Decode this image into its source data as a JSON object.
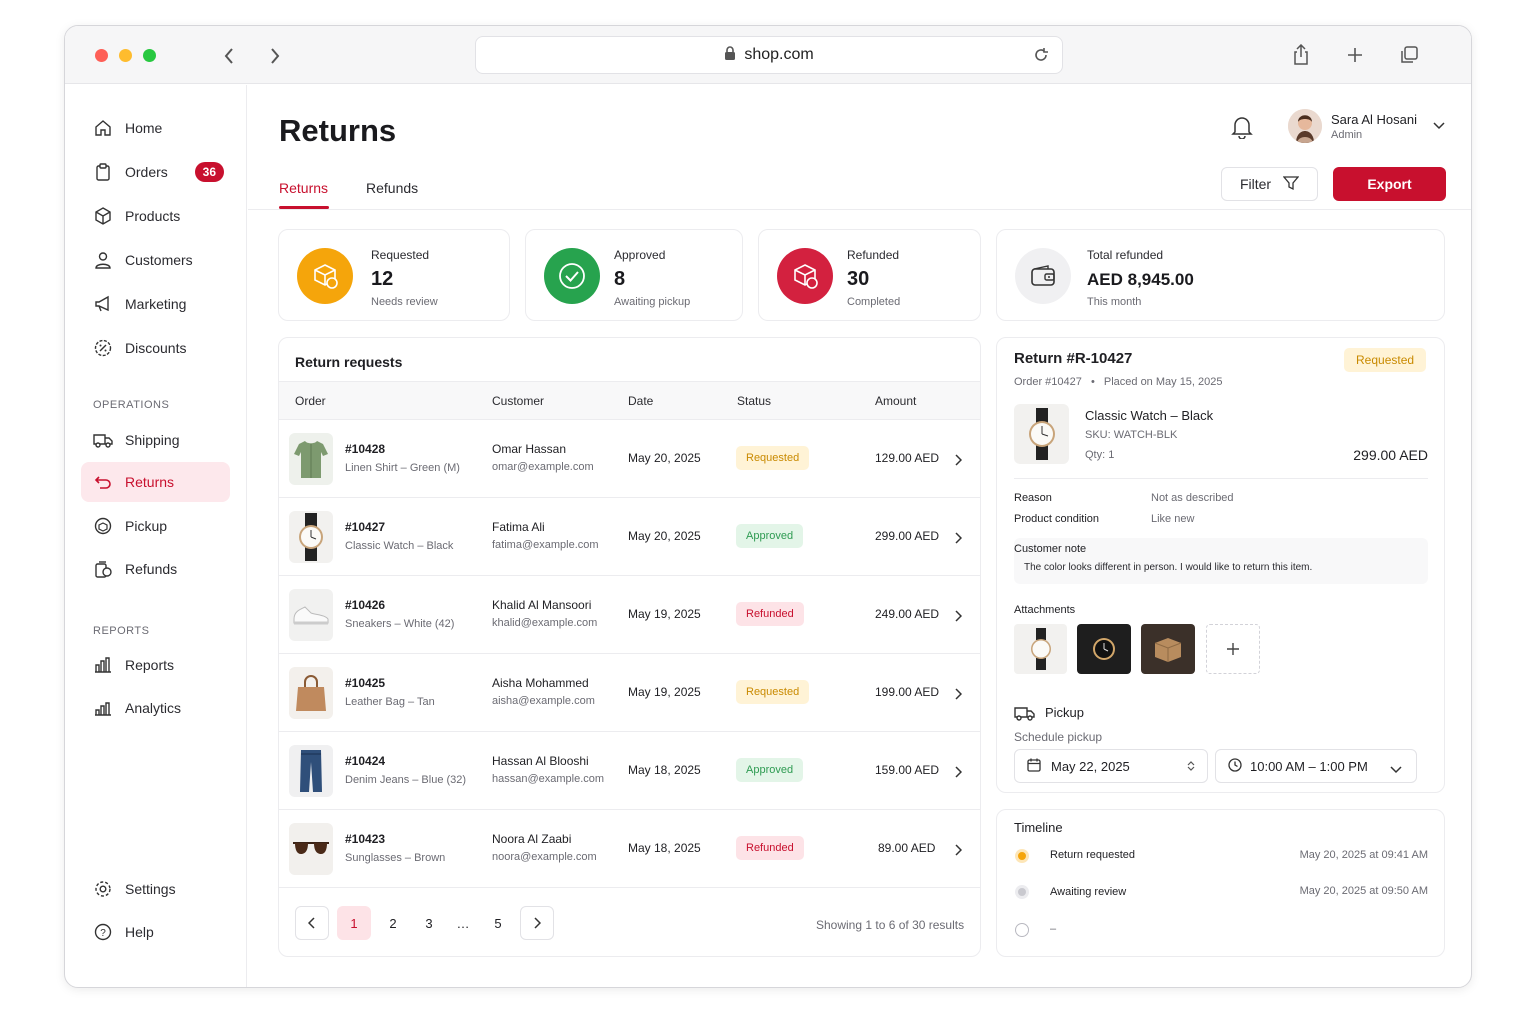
{
  "browser": {
    "url": "shop.com"
  },
  "sidebar": {
    "items": [
      {
        "label": "Home"
      },
      {
        "label": "Orders",
        "badge": "36"
      },
      {
        "label": "Products"
      },
      {
        "label": "Customers"
      },
      {
        "label": "Marketing"
      },
      {
        "label": "Discounts"
      }
    ],
    "operations_heading": "OPERATIONS",
    "operations": [
      {
        "label": "Shipping"
      },
      {
        "label": "Returns"
      },
      {
        "label": "Pickup"
      },
      {
        "label": "Refunds"
      }
    ],
    "reports_heading": "REPORTS",
    "reports": [
      {
        "label": "Reports"
      },
      {
        "label": "Analytics"
      }
    ],
    "footer": [
      {
        "label": "Settings"
      },
      {
        "label": "Help"
      }
    ],
    "active": "Returns",
    "accent": "#c8102e"
  },
  "header": {
    "title": "Returns",
    "tabs": [
      {
        "label": "Returns"
      },
      {
        "label": "Refunds"
      }
    ],
    "user": {
      "name": "Sara Al Hosani",
      "role": "Admin"
    },
    "filter_label": "Filter",
    "export_label": "Export"
  },
  "kpis": [
    {
      "label": "Requested",
      "value": "12",
      "sub": "Needs review",
      "color": "#f5a50b",
      "icon": "box-return-icon"
    },
    {
      "label": "Approved",
      "value": "8",
      "sub": "Awaiting pickup",
      "color": "#27a34e",
      "icon": "check-circle-icon"
    },
    {
      "label": "Refunded",
      "value": "30",
      "sub": "Completed",
      "color": "#d3213f",
      "icon": "box-refund-icon"
    },
    {
      "label": "Total refunded",
      "value": "AED 8,945.00",
      "sub": "This month",
      "color": "#f0f0f2",
      "icon": "wallet-icon"
    }
  ],
  "table": {
    "title": "Return requests",
    "columns": [
      "Order",
      "Customer",
      "Date",
      "Status",
      "Amount"
    ],
    "rows": [
      {
        "order": "#10428",
        "item": "Linen Shirt – Green (M)",
        "customer": "Omar Hassan",
        "email": "omar@example.com",
        "date": "May 20, 2025",
        "status": "Requested",
        "amount": "129.00 AED",
        "thumb": "shirt-icon"
      },
      {
        "order": "#10427",
        "item": "Classic Watch – Black",
        "customer": "Fatima Ali",
        "email": "fatima@example.com",
        "date": "May 20, 2025",
        "status": "Approved",
        "amount": "299.00 AED",
        "thumb": "watch-icon"
      },
      {
        "order": "#10426",
        "item": "Sneakers – White (42)",
        "customer": "Khalid Al Mansoori",
        "email": "khalid@example.com",
        "date": "May 19, 2025",
        "status": "Refunded",
        "amount": "249.00 AED",
        "thumb": "sneaker-icon"
      },
      {
        "order": "#10425",
        "item": "Leather Bag – Tan",
        "customer": "Aisha Mohammed",
        "email": "aisha@example.com",
        "date": "May 19, 2025",
        "status": "Requested",
        "amount": "199.00 AED",
        "thumb": "bag-icon"
      },
      {
        "order": "#10424",
        "item": "Denim Jeans – Blue (32)",
        "customer": "Hassan Al Blooshi",
        "email": "hassan@example.com",
        "date": "May 18, 2025",
        "status": "Approved",
        "amount": "159.00 AED",
        "thumb": "jeans-icon"
      },
      {
        "order": "#10423",
        "item": "Sunglasses – Brown",
        "customer": "Noora Al Zaabi",
        "email": "noora@example.com",
        "date": "May 18, 2025",
        "status": "Refunded",
        "amount": "89.00 AED",
        "thumb": "sunglasses-icon"
      }
    ],
    "pagination": {
      "pages": [
        "1",
        "2",
        "3",
        "…",
        "5"
      ],
      "current": "1",
      "summary": "Showing 1 to 6 of 30 results"
    }
  },
  "detail": {
    "title": "Return #R-10427",
    "status": "Requested",
    "order": "Order #10427",
    "sep": "•",
    "placed": "Placed on May 15, 2025",
    "product": {
      "name": "Classic Watch – Black",
      "sku": "SKU: WATCH-BLK",
      "qty": "Qty: 1",
      "price": "299.00 AED"
    },
    "reason_label": "Reason",
    "reason": "Not as described",
    "condition_label": "Product condition",
    "condition": "Like new",
    "note_label": "Customer note",
    "note": "The color looks different in person. I would like to return this item.",
    "attachments_label": "Attachments",
    "pickup_label": "Pickup",
    "schedule_label": "Schedule pickup",
    "pickup_date": "May 22, 2025",
    "pickup_time": "10:00 AM – 1:00 PM"
  },
  "timeline": {
    "title": "Timeline",
    "events": [
      {
        "label": "Return requested",
        "time": "May 20, 2025 at 09:41 AM",
        "state": "current"
      },
      {
        "label": "Awaiting review",
        "time": "May 20, 2025 at 09:50 AM",
        "state": "done"
      },
      {
        "label": "–",
        "time": "",
        "state": "pending"
      }
    ]
  }
}
